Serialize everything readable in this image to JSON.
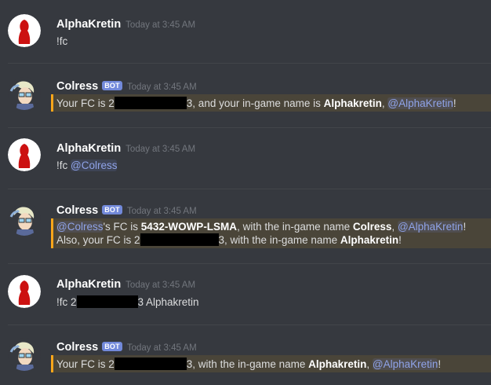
{
  "messages": [
    {
      "author": "AlphaKretin",
      "timestamp": "Today at 3:45 AM",
      "text": "!fc"
    },
    {
      "author": "Colress",
      "bot_tag": "BOT",
      "timestamp": "Today at 3:45 AM",
      "parts": {
        "a": "Your FC is 2",
        "b": "3, and your in-game name is ",
        "name": "Alphakretin",
        "c": ", ",
        "mention": "@AlphaKretin",
        "d": "!"
      }
    },
    {
      "author": "AlphaKretin",
      "timestamp": "Today at 3:45 AM",
      "text": "!fc ",
      "mention": "@Colress"
    },
    {
      "author": "Colress",
      "bot_tag": "BOT",
      "timestamp": "Today at 3:45 AM",
      "line1": {
        "mention1": "@Colress",
        "a": "'s FC is ",
        "fc": "5432-WOWP-LSMA",
        "b": ", with the in-game name ",
        "name": "Colress",
        "c": ", ",
        "mention2": "@AlphaKretin",
        "d": "!"
      },
      "line2": {
        "a": "Also, your FC is 2",
        "b": "3, with the in-game name ",
        "name": "Alphakretin",
        "c": "!"
      }
    },
    {
      "author": "AlphaKretin",
      "timestamp": "Today at 3:45 AM",
      "a": "!fc 2",
      "b": "3 Alphakretin"
    },
    {
      "author": "Colress",
      "bot_tag": "BOT",
      "timestamp": "Today at 3:45 AM",
      "parts": {
        "a": "Your FC is 2",
        "b": "3, with the in-game name ",
        "name": "Alphakretin",
        "c": ", ",
        "mention": "@AlphaKretin",
        "d": "!"
      }
    }
  ],
  "colors": {
    "background": "#36393f",
    "mention": "#8fa3e8",
    "highlight_bar": "#faa61a",
    "bot_tag": "#7289da",
    "avatar_red": "#cc1111"
  }
}
